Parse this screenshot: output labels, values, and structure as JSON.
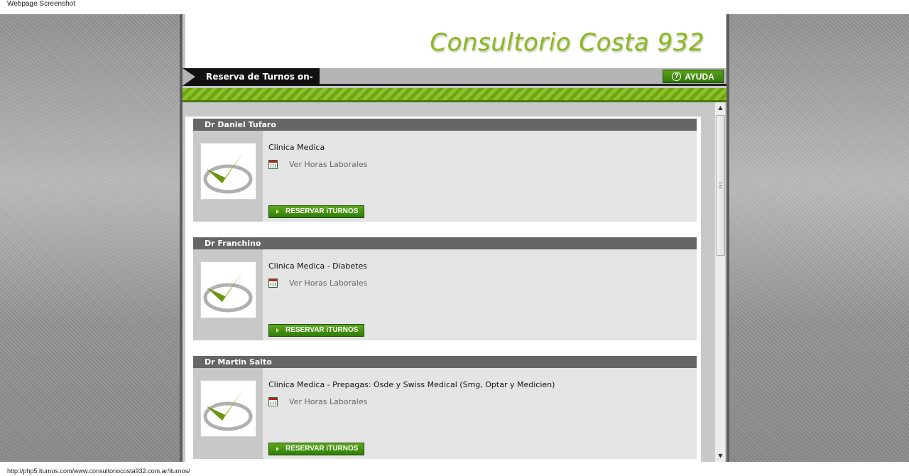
{
  "caption": "Webpage Screenshot",
  "site": {
    "title": "Consultorio Costa 932"
  },
  "nav": {
    "tab_label": "Reserva de Turnos on-line",
    "help_label": "AYUDA",
    "help_icon": "question-circle-icon"
  },
  "doctors": [
    {
      "name": "Dr Daniel Tufaro",
      "specialty": "Clinica Medica",
      "hours_label": "Ver Horas Laborales",
      "reserve_label": "RESERVAR iTURNOS"
    },
    {
      "name": "Dr Franchino",
      "specialty": "Clinica Medica - Diabetes",
      "hours_label": "Ver Horas Laborales",
      "reserve_label": "RESERVAR iTURNOS"
    },
    {
      "name": "Dr Martin Salto",
      "specialty": "Clinica Medica - Prepagas: Osde y Swiss Medical (Smg, Optar y Medicien)",
      "hours_label": "Ver Horas Laborales",
      "reserve_label": "RESERVAR iTURNOS"
    }
  ],
  "status": {
    "url": "http://php5.iturnos.com/www.consultoriocosta932.com.ar/iturnos/"
  },
  "colors": {
    "accent_green": "#8ab820",
    "button_green": "#3c8a0e",
    "card_header": "#666666"
  }
}
